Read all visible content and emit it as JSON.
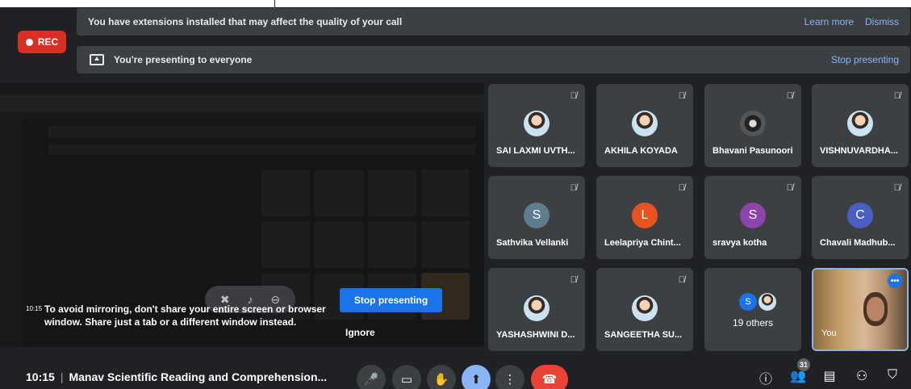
{
  "banners": {
    "extensions_text": "You have extensions installed that may affect the quality of your call",
    "learn_more": "Learn more",
    "dismiss": "Dismiss",
    "presenting_text": "You're presenting to everyone",
    "stop_presenting": "Stop presenting"
  },
  "rec_label": "REC",
  "shared_screen": {
    "warning_time": "10:15",
    "warning_text": "To avoid mirroring, don't share your entire screen or browser window. Share just a tab or a different window instead.",
    "stop_button": "Stop presenting",
    "ignore": "Ignore"
  },
  "participants": [
    {
      "name": "SAI LAXMI UVTH...",
      "initial": "",
      "color": "",
      "type": "photo"
    },
    {
      "name": "AKHILA KOYADA",
      "initial": "",
      "color": "",
      "type": "photo"
    },
    {
      "name": "Bhavani Pasunoori",
      "initial": "",
      "color": "",
      "type": "photo"
    },
    {
      "name": "VISHNUVARDHA...",
      "initial": "",
      "color": "",
      "type": "photo"
    },
    {
      "name": "Sathvika Vellanki",
      "initial": "S",
      "color": "#5f7d8e"
    },
    {
      "name": "Leelapriya Chint...",
      "initial": "L",
      "color": "#e8521f"
    },
    {
      "name": "sravya kotha",
      "initial": "S",
      "color": "#8e44ad"
    },
    {
      "name": "Chavali Madhub...",
      "initial": "C",
      "color": "#4a5fc1"
    },
    {
      "name": "YASHASHWINI D...",
      "initial": "",
      "color": "",
      "type": "photo"
    },
    {
      "name": "SANGEETHA SU...",
      "initial": "",
      "color": "",
      "type": "photo"
    }
  ],
  "others_tile": {
    "label": "19 others",
    "initial": "S",
    "color": "#1a73e8"
  },
  "self_tile": {
    "name": "You"
  },
  "bottom": {
    "time": "10:15",
    "separator": "|",
    "meeting_title": "Manav Scientific Reading and Comprehension...",
    "participant_count": "31"
  },
  "colors": {
    "background": "#202124",
    "tile": "#3c4043",
    "accent": "#8ab4f8",
    "primary_button": "#1a73e8",
    "rec": "#d93025",
    "hang_up": "#ea4335"
  }
}
